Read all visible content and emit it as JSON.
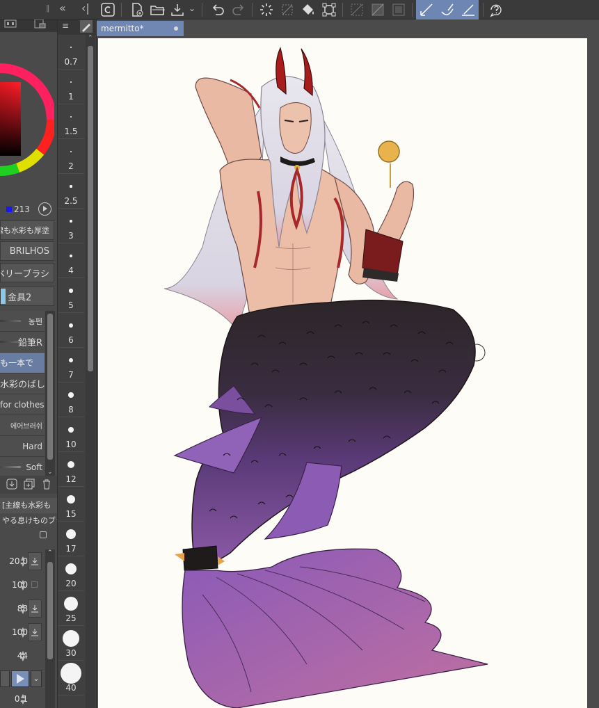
{
  "document": {
    "tab_title": "mermitto*"
  },
  "left_panel": {
    "rgb_blue_value": "213",
    "sub_tool_groups": [
      "線も水彩も厚塗",
      "BRILHOS",
      "ベリーブラシ",
      "金具2"
    ],
    "brushes": [
      "농펜",
      "鉛筆R",
      "も一本で",
      "水彩のばし",
      "for clothes",
      "에어브러쉬",
      "Hard",
      "Soft"
    ],
    "property_title": "[主線も水彩も",
    "property_subtitle": "やる息けものブラ",
    "properties": [
      "20.0",
      "100",
      "88",
      "100",
      "44",
      "0.1"
    ]
  },
  "brush_sizes": [
    "0.7",
    "1",
    "1.5",
    "2",
    "2.5",
    "3",
    "4",
    "5",
    "6",
    "7",
    "8",
    "10",
    "12",
    "15",
    "17",
    "20",
    "25",
    "30",
    "40"
  ],
  "colors": {
    "toolbar_bg": "#3a3a3a",
    "panel_bg": "#4a4a4a",
    "accent": "#6d86b4",
    "paper": "#fdfcf6"
  }
}
